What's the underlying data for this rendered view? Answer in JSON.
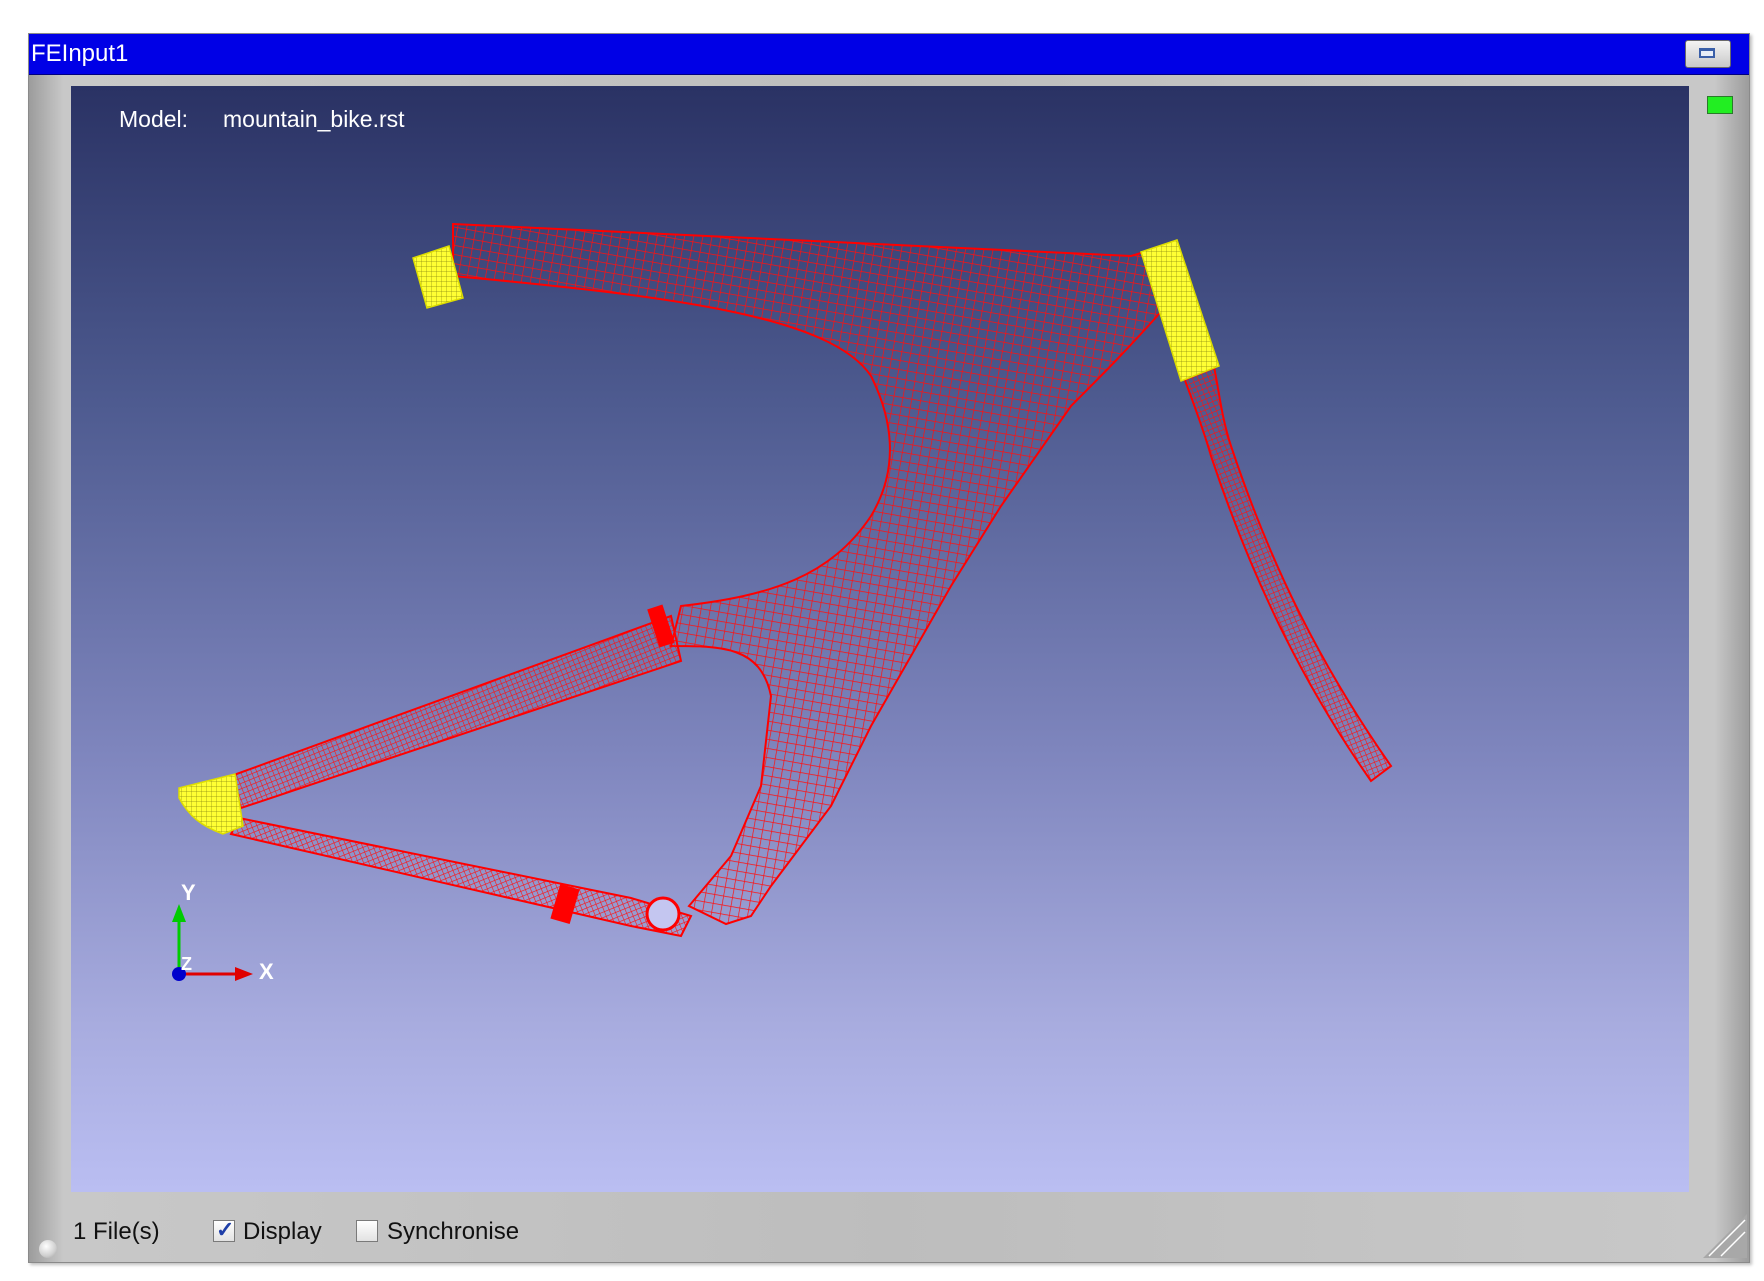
{
  "window": {
    "title": "FEInput1",
    "restore_button": "restore-icon"
  },
  "viewport": {
    "model_label": "Model:",
    "model_name": "mountain_bike.rst",
    "colors": {
      "mesh": "#ff0000",
      "constraints": "#ffff00",
      "background_top": "#2a3264",
      "background_bottom": "#babef2"
    }
  },
  "triad": {
    "y_label": "Y",
    "x_label": "X",
    "z_label": "Z"
  },
  "statusbar": {
    "files_count": "1 File(s)",
    "display_label": "Display",
    "display_checked": true,
    "synchronise_label": "Synchronise",
    "synchronise_checked": false
  }
}
